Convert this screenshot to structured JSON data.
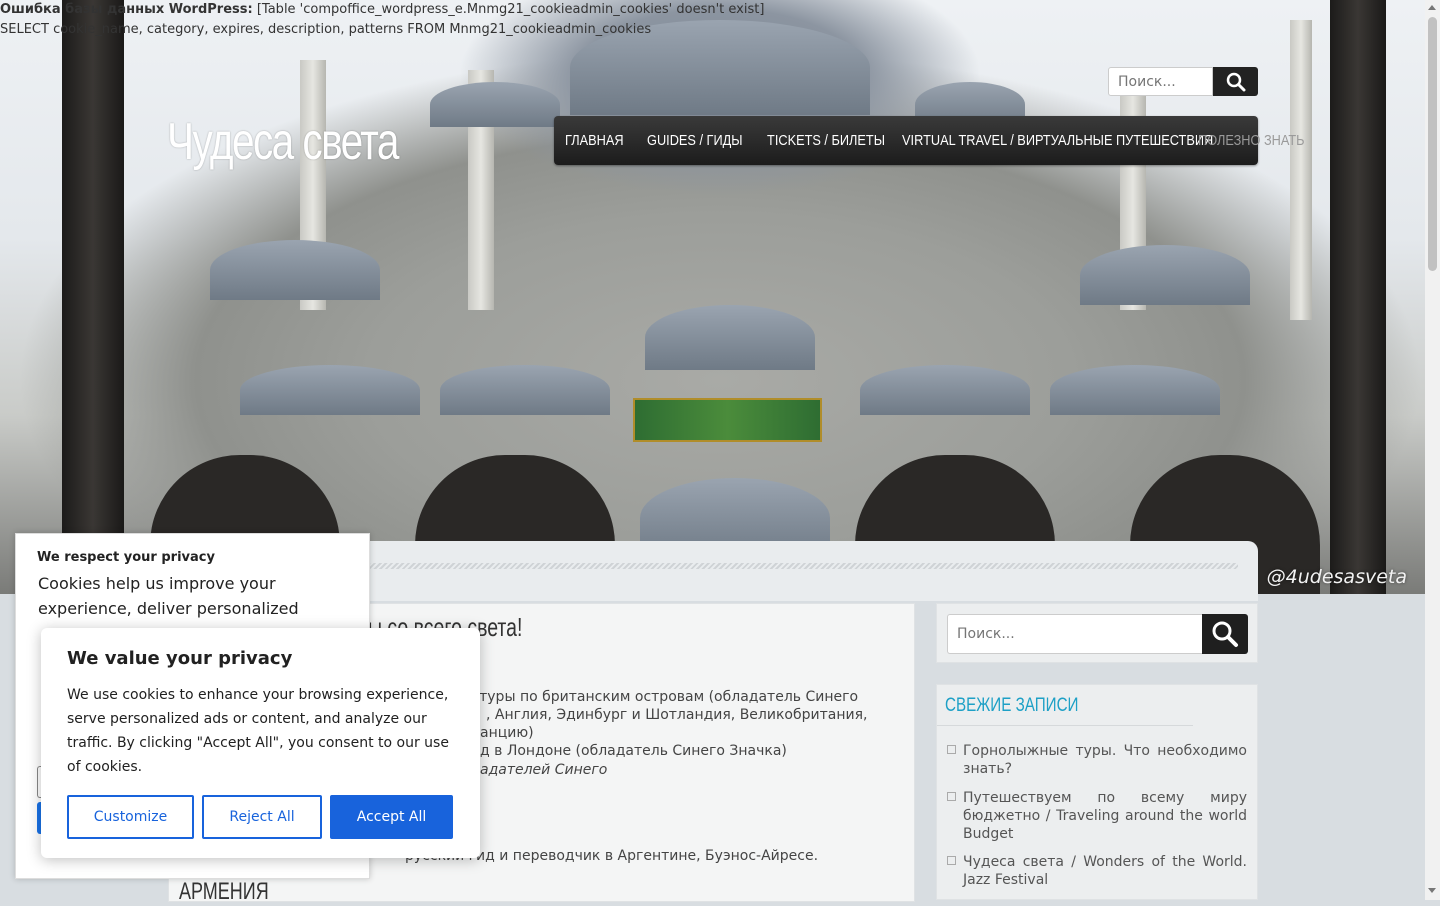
{
  "db_error": {
    "label": "Ошибка базы данных WordPress:",
    "message": "[Table 'compoffice_wordpress_e.Mnmg21_cookieadmin_cookies' doesn't exist]",
    "query": "SELECT cookie_name, category, expires, description, patterns FROM Mnmg21_cookieadmin_cookies"
  },
  "site": {
    "title": "Чудеса света",
    "watermark": "@4udesasveta"
  },
  "header_search": {
    "placeholder": "Поиск..."
  },
  "nav": {
    "items": [
      {
        "label": "ГЛАВНАЯ"
      },
      {
        "label": "GUIDES / ГИДЫ"
      },
      {
        "label": "TICKETS / БИЛЕТЫ"
      },
      {
        "label": "VIRTUAL TRAVEL / ВИРТУАЛЬНЫЕ ПУТЕШЕСТВИЯ"
      },
      {
        "label": "ПОЛЕЗНО ЗНАТЬ"
      }
    ]
  },
  "main": {
    "post_title": "ы со всего света!",
    "lines": [
      "ые туры по британским островам (обладатель Синего",
      ", Англия, Эдинбург и Шотландия, Великобритания,",
      "анцию)",
      "д в Лондоне (обладатель Синего Значка)",
      "адателей Синего",
      "русский гид и переводчик в Аргентине, Буэнос-Айресе."
    ],
    "section_heading": "АРМЕНИЯ"
  },
  "sidebar": {
    "search_placeholder": "Поиск...",
    "recent_title": "СВЕЖИЕ ЗАПИСИ",
    "recent_posts": [
      "Горнолыжные туры. Что необходимо знать?",
      "Путешествуем по всему миру бюджетно / Traveling around the world Budget",
      "Чудеса света / Wonders of the World. Jazz Festival"
    ]
  },
  "cookie_back": {
    "title": "We respect your privacy",
    "body": "Cookies help us improve your experience, deliver personalized"
  },
  "cookie_front": {
    "title": "We value your privacy",
    "body": "We use cookies to enhance your browsing experience, serve personalized ads or content, and analyze our traffic. By clicking \"Accept All\", you consent to our use of cookies.",
    "customize": "Customize",
    "reject": "Reject All",
    "accept": "Accept All"
  }
}
